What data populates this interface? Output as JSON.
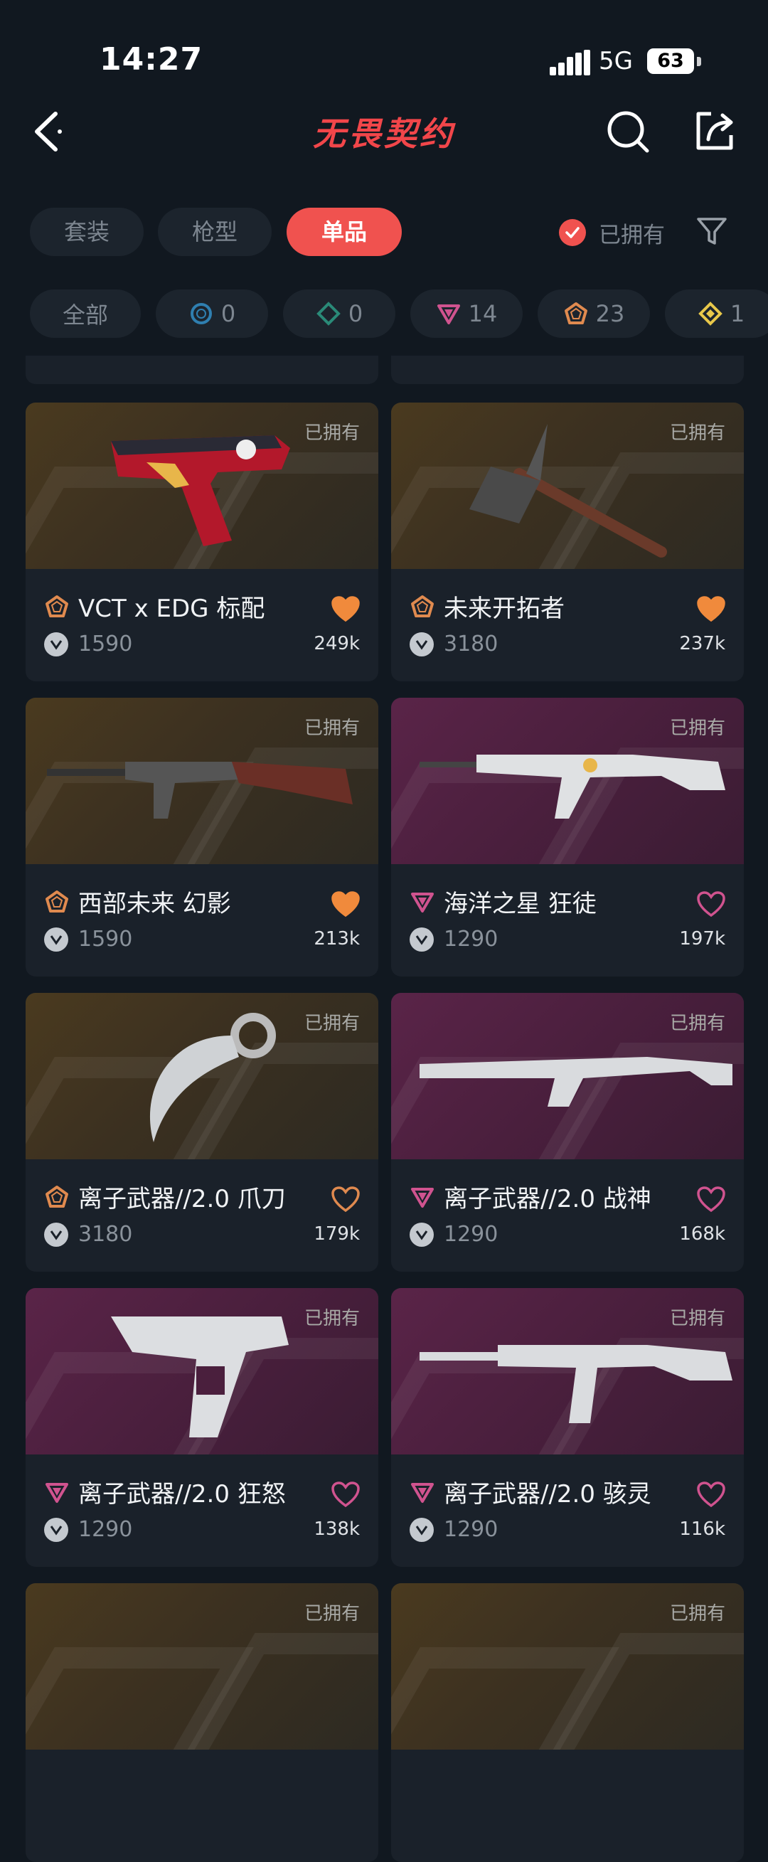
{
  "status": {
    "time": "14:27",
    "network": "5G",
    "battery": "63"
  },
  "nav": {
    "title": "无畏契约"
  },
  "tabs": [
    {
      "label": "套装"
    },
    {
      "label": "枪型"
    },
    {
      "label": "单品"
    }
  ],
  "owned_filter": {
    "label": "已拥有",
    "checked": true
  },
  "rarity_chips": [
    {
      "label": "全部"
    },
    {
      "icon": "select-tier-icon",
      "count": "0",
      "color": "#2f7fb0"
    },
    {
      "icon": "deluxe-tier-icon",
      "count": "0",
      "color": "#2a8a78"
    },
    {
      "icon": "premium-tier-icon",
      "count": "14",
      "color": "#d0538f"
    },
    {
      "icon": "exclusive-tier-icon",
      "count": "23",
      "color": "#e08a4f"
    },
    {
      "icon": "ultra-tier-icon",
      "count": "1",
      "color": "#e8c84a"
    }
  ],
  "items": [
    {
      "name": "VCT x EDG 标配",
      "price": "1590",
      "likes": "249k",
      "owned": "已拥有",
      "tier": "exclusive",
      "favorited": true
    },
    {
      "name": "未来开拓者",
      "price": "3180",
      "likes": "237k",
      "owned": "已拥有",
      "tier": "exclusive",
      "favorited": true
    },
    {
      "name": "西部未来 幻影",
      "price": "1590",
      "likes": "213k",
      "owned": "已拥有",
      "tier": "exclusive",
      "favorited": true
    },
    {
      "name": "海洋之星 狂徒",
      "price": "1290",
      "likes": "197k",
      "owned": "已拥有",
      "tier": "premium",
      "favorited": false
    },
    {
      "name": "离子武器//2.0 爪刀",
      "price": "3180",
      "likes": "179k",
      "owned": "已拥有",
      "tier": "exclusive",
      "favorited": false
    },
    {
      "name": "离子武器//2.0 战神",
      "price": "1290",
      "likes": "168k",
      "owned": "已拥有",
      "tier": "premium",
      "favorited": false
    },
    {
      "name": "离子武器//2.0 狂怒",
      "price": "1290",
      "likes": "138k",
      "owned": "已拥有",
      "tier": "premium",
      "favorited": false
    },
    {
      "name": "离子武器//2.0 骇灵",
      "price": "1290",
      "likes": "116k",
      "owned": "已拥有",
      "tier": "premium",
      "favorited": false
    },
    {
      "owned": "已拥有"
    },
    {
      "owned": "已拥有"
    }
  ]
}
